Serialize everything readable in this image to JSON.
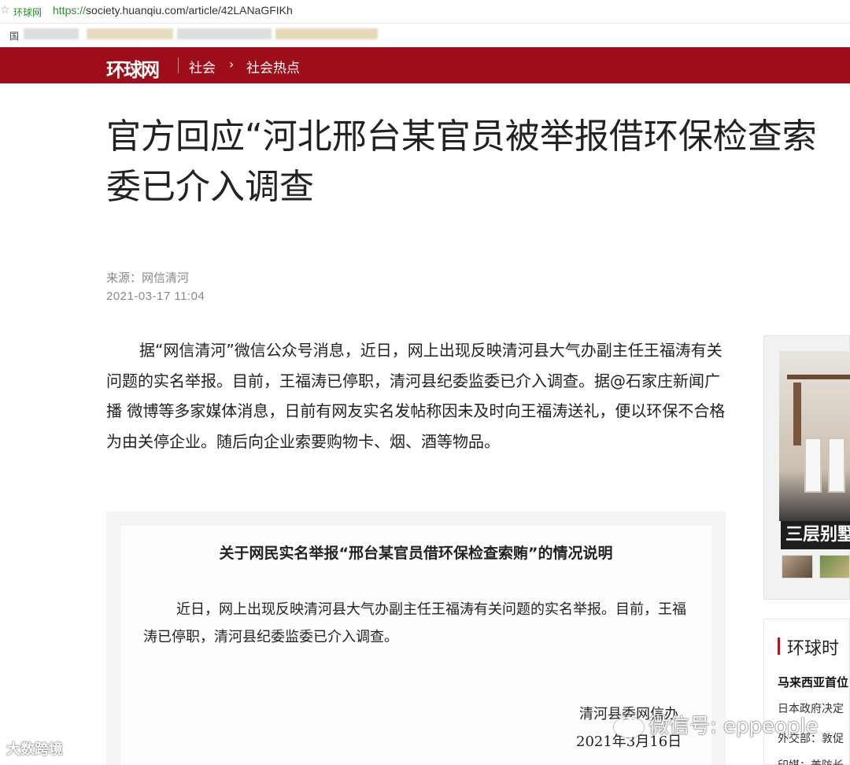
{
  "browser": {
    "tab_site": "环球网",
    "url_scheme": "https://",
    "url_rest": "society.huanqiu.com/article/42LANaGFIKh",
    "bookmark_label": "国"
  },
  "header": {
    "logo": "环球网",
    "crumb_1": "社会",
    "crumb_arrow": "›",
    "crumb_2": "社会热点"
  },
  "article": {
    "title_line1": "官方回应“河北邢台某官员被举报借环保检查索",
    "title_line2": "委已介入调查",
    "source": "来源：网信清河",
    "datetime": "2021-03-17 11:04",
    "body": "据“网信清河”微信公众号消息，近日，网上出现反映清河县大气办副主任王福涛有关问题的实名举报。目前，王福涛已停职，清河县纪委监委已介入调查。据@石家庄新闻广播 微博等多家媒体消息，日前有网友实名发帖称因未及时向王福涛送礼，便以环保不合格为由关停企业。随后向企业索要购物卡、烟、酒等物品。"
  },
  "notice": {
    "title": "关于网民实名举报“邢台某官员借环保检查索贿”的情况说明",
    "body": "近日，网上出现反映清河县大气办副主任王福涛有关问题的实名举报。目前，王福涛已停职，清河县纪委监委已介入调查。",
    "signature": "清河县委网信办",
    "date": "2021年3月16日"
  },
  "sidebar": {
    "ad_caption": "三层别墅",
    "news_heading": "环球时",
    "news_items": [
      "马来西亚首位",
      "日本政府决定",
      "外交部：敦促",
      "印媒：美防长"
    ]
  },
  "watermarks": {
    "left": "大数跨境",
    "right": "微信号: eppeople"
  }
}
